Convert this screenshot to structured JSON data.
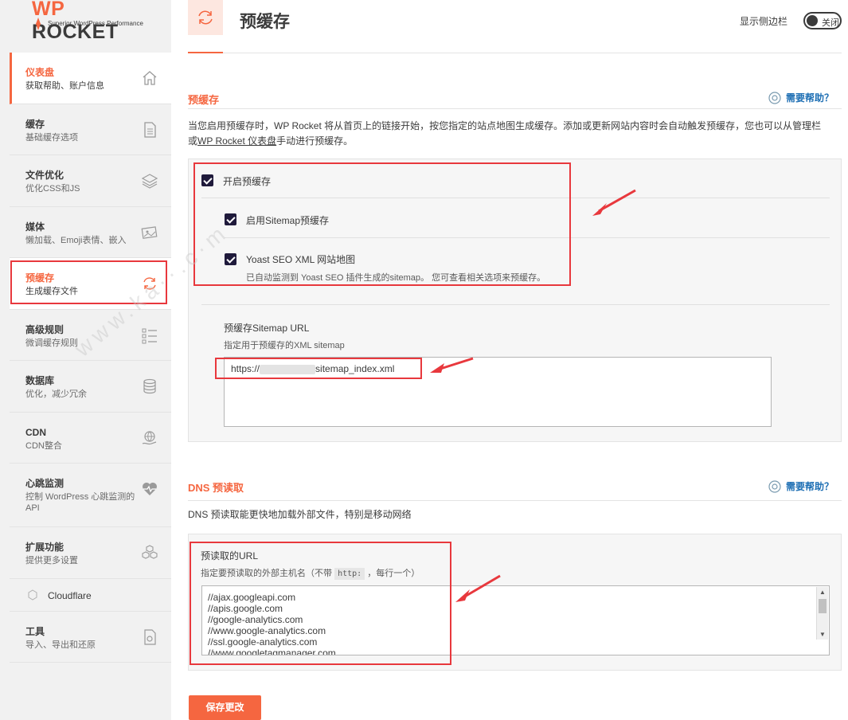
{
  "logo": {
    "brand_wp": "WP",
    "brand_rest": " ROCKET",
    "tagline": "Superior WordPress Performance"
  },
  "sidebar": {
    "items": [
      {
        "title": "仪表盘",
        "sub": "获取帮助、账户信息",
        "icon": "home-icon"
      },
      {
        "title": "缓存",
        "sub": "基础缓存选项",
        "icon": "document-icon"
      },
      {
        "title": "文件优化",
        "sub": "优化CSS和JS",
        "icon": "layers-icon"
      },
      {
        "title": "媒体",
        "sub": "懒加载、Emoji表情、嵌入",
        "icon": "media-icon"
      },
      {
        "title": "预缓存",
        "sub": "生成缓存文件",
        "icon": "refresh-icon"
      },
      {
        "title": "高级规则",
        "sub": "微调缓存规则",
        "icon": "list-icon"
      },
      {
        "title": "数据库",
        "sub": "优化，减少冗余",
        "icon": "database-icon"
      },
      {
        "title": "CDN",
        "sub": "CDN整合",
        "icon": "cdn-icon"
      },
      {
        "title": "心跳监测",
        "sub": "控制 WordPress 心跳监测的 API",
        "icon": "heartbeat-icon"
      },
      {
        "title": "扩展功能",
        "sub": "提供更多设置",
        "icon": "addons-icon"
      },
      {
        "title": "Cloudflare",
        "sub": "",
        "icon": "cloudflare-icon"
      },
      {
        "title": "工具",
        "sub": "导入、导出和还原",
        "icon": "tools-icon"
      }
    ]
  },
  "header": {
    "title": "预缓存",
    "sidebar_toggle_label": "显示侧边栏",
    "toggle_state": "关闭"
  },
  "preload": {
    "section_title": "预缓存",
    "help": "需要帮助？",
    "description_1": "当您启用预缓存时，WP Rocket 将从首页上的链接开始，按您指定的站点地图生成缓存。添加或更新网站内容时会自动触发预缓存，您也可以从管理栏",
    "description_2a": "或",
    "description_2_link": "WP Rocket 仪表盘",
    "description_2b": "手动进行预缓存。",
    "option_enable": "开启预缓存",
    "option_sitemap": "启用Sitemap预缓存",
    "option_yoast": "Yoast SEO XML 网站地图",
    "option_yoast_sub": "已自动监测到 Yoast SEO 插件生成的sitemap。 您可查看相关选项来预缓存。",
    "sitemap_label": "预缓存Sitemap URL",
    "sitemap_sub": "指定用于预缓存的XML sitemap",
    "sitemap_value_prefix": "https://",
    "sitemap_value_suffix": "sitemap_index.xml"
  },
  "dns": {
    "section_title": "DNS 预读取",
    "help": "需要帮助？",
    "description": "DNS 预读取能更快地加载外部文件，特别是移动网络",
    "field_label": "预读取的URL",
    "field_sub_a": "指定要预读取的外部主机名（不带",
    "field_sub_code": "http:",
    "field_sub_b": "，每行一个）",
    "urls": [
      "//ajax.googleapi.com",
      "//apis.google.com",
      "//google-analytics.com",
      "//www.google-analytics.com",
      "//ssl.google-analytics.com",
      "//www.googletagmanager.com"
    ]
  },
  "save_label": "保存更改",
  "colors": {
    "accent": "#f56640",
    "annotation_red": "#e8383d",
    "link": "#1e6fb4"
  }
}
